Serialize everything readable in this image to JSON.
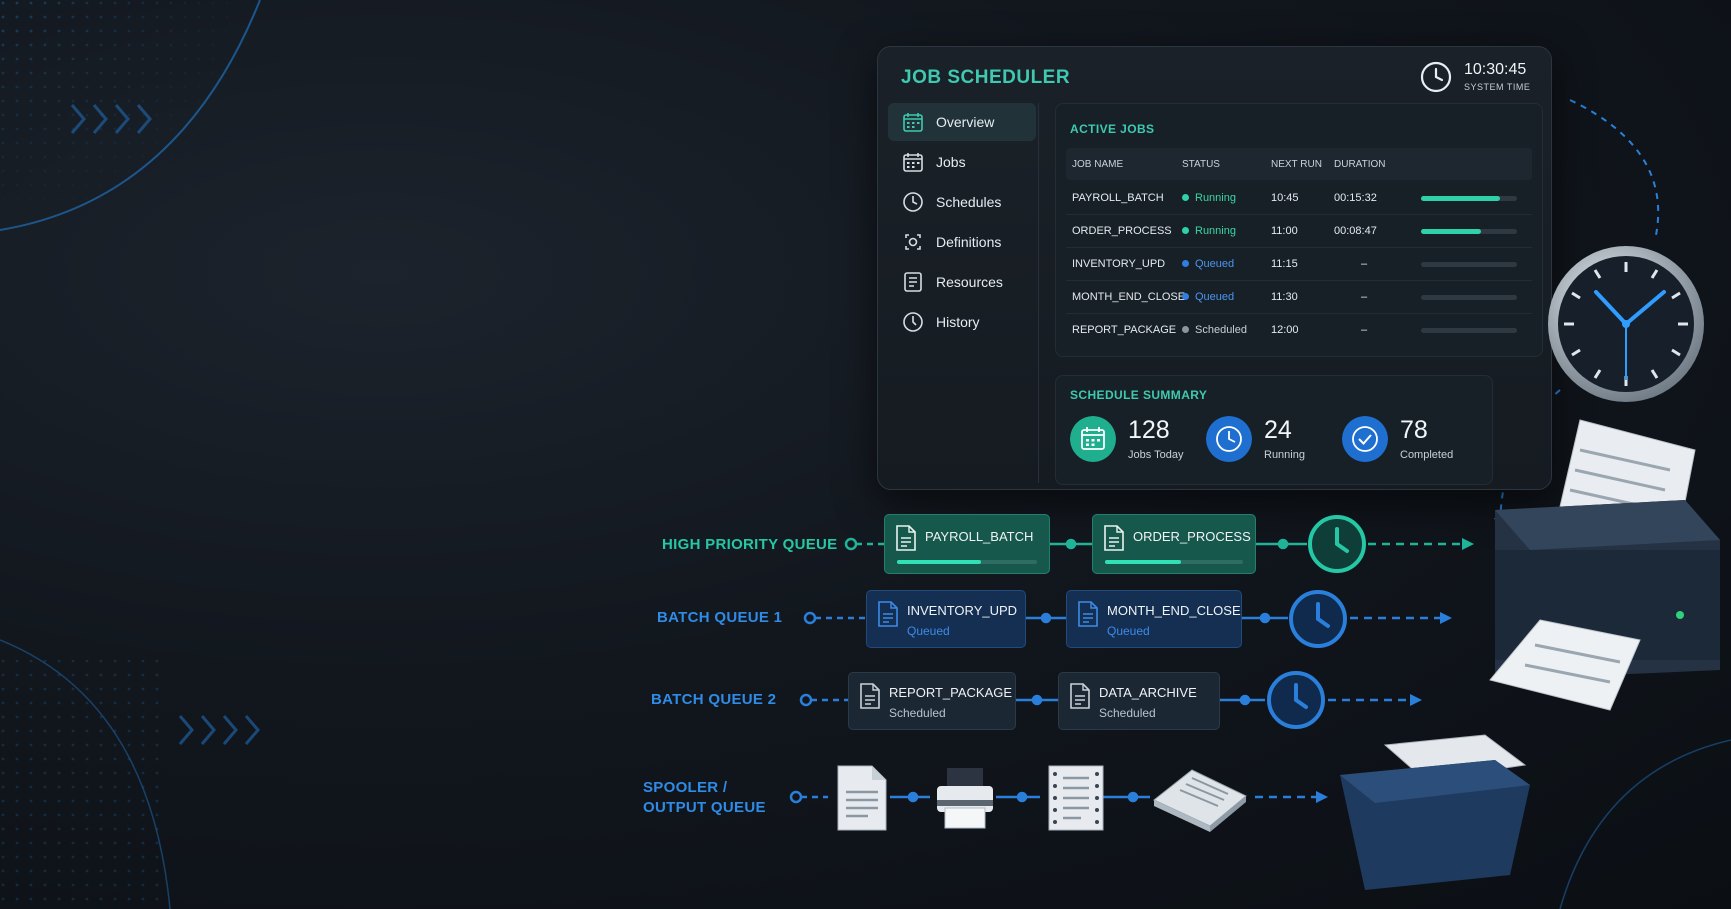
{
  "scheduler": {
    "title": "JOB SCHEDULER",
    "system_time": "10:30:45",
    "system_time_label": "SYSTEM TIME",
    "sidebar": [
      {
        "label": "Overview",
        "icon": "calendar-icon",
        "active": true
      },
      {
        "label": "Jobs",
        "icon": "calendar-grid-icon",
        "active": false
      },
      {
        "label": "Schedules",
        "icon": "clock-icon",
        "active": false
      },
      {
        "label": "Definitions",
        "icon": "definitions-icon",
        "active": false
      },
      {
        "label": "Resources",
        "icon": "resources-icon",
        "active": false
      },
      {
        "label": "History",
        "icon": "history-icon",
        "active": false
      }
    ],
    "active_jobs": {
      "title": "ACTIVE JOBS",
      "columns": [
        "JOB NAME",
        "STATUS",
        "NEXT RUN",
        "DURATION"
      ],
      "rows": [
        {
          "name": "PAYROLL_BATCH",
          "status": "Running",
          "next_run": "10:45",
          "duration": "00:15:32",
          "progress": 0.82
        },
        {
          "name": "ORDER_PROCESS",
          "status": "Running",
          "next_run": "11:00",
          "duration": "00:08:47",
          "progress": 0.62
        },
        {
          "name": "INVENTORY_UPD",
          "status": "Queued",
          "next_run": "11:15",
          "duration": "–",
          "progress": 0
        },
        {
          "name": "MONTH_END_CLOSE",
          "status": "Queued",
          "next_run": "11:30",
          "duration": "–",
          "progress": 0
        },
        {
          "name": "REPORT_PACKAGE",
          "status": "Scheduled",
          "next_run": "12:00",
          "duration": "–",
          "progress": 0
        }
      ]
    },
    "summary": {
      "title": "SCHEDULE SUMMARY",
      "stats": [
        {
          "value": "128",
          "label": "Jobs Today",
          "icon": "calendar-icon"
        },
        {
          "value": "24",
          "label": "Running",
          "icon": "clock-icon"
        },
        {
          "value": "78",
          "label": "Completed",
          "icon": "check-icon"
        }
      ]
    }
  },
  "queues": {
    "high": {
      "label": "HIGH PRIORITY QUEUE",
      "jobs": [
        {
          "name": "PAYROLL_BATCH",
          "progress": 0.6
        },
        {
          "name": "ORDER_PROCESS",
          "progress": 0.55
        }
      ]
    },
    "batch1": {
      "label": "BATCH QUEUE 1",
      "jobs": [
        {
          "name": "INVENTORY_UPD",
          "status": "Queued"
        },
        {
          "name": "MONTH_END_CLOSE",
          "status": "Queued"
        }
      ]
    },
    "batch2": {
      "label": "BATCH QUEUE 2",
      "jobs": [
        {
          "name": "REPORT_PACKAGE",
          "status": "Scheduled"
        },
        {
          "name": "DATA_ARCHIVE",
          "status": "Scheduled"
        }
      ]
    },
    "spooler": {
      "label_line1": "SPOOLER /",
      "label_line2": "OUTPUT QUEUE"
    }
  },
  "colors": {
    "teal": "#3ec9b0",
    "running": "#2fd1a8",
    "queued": "#2f7fe0",
    "scheduled": "#8a959f",
    "blue_label": "#2f8be6"
  }
}
